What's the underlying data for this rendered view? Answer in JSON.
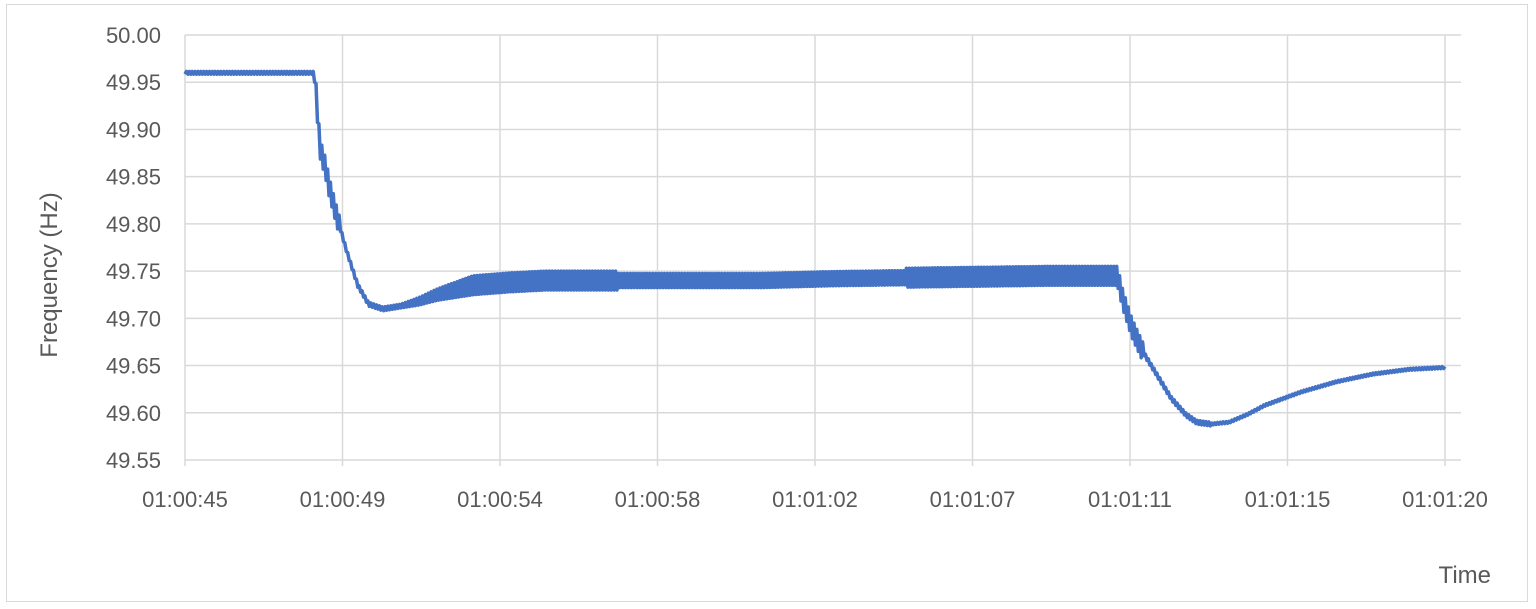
{
  "chart_data": {
    "type": "line",
    "xlabel": "Time",
    "ylabel": "Frequency (Hz)",
    "ylim": [
      49.55,
      50.0
    ],
    "y_ticks": [
      "49.55",
      "49.60",
      "49.65",
      "49.70",
      "49.75",
      "49.80",
      "49.85",
      "49.90",
      "49.95",
      "50.00"
    ],
    "x_tick_labels": [
      "01:00:45",
      "01:00:49",
      "01:00:54",
      "01:00:58",
      "01:01:02",
      "01:01:07",
      "01:01:11",
      "01:01:15",
      "01:01:20"
    ],
    "grid": true,
    "line_color": "#4472c4",
    "series": [
      {
        "x_seconds": [
          0,
          3.6,
          3.75,
          3.9,
          4.0,
          4.2,
          4.5,
          4.8,
          5.1,
          5.5,
          6.0,
          6.5,
          7.0,
          7.5,
          8.0,
          9.0,
          10.0,
          12.0,
          14.0,
          16.0,
          18.0,
          20.0,
          22.0,
          24.0,
          25.5,
          25.9,
          26.05,
          26.3,
          26.6,
          27.0,
          27.4,
          27.8,
          28.1,
          28.5,
          29.0,
          29.5,
          30.0,
          31.0,
          32.0,
          33.0,
          34.0,
          35.0
        ],
        "values": [
          49.96,
          49.96,
          49.88,
          49.86,
          49.84,
          49.81,
          49.77,
          49.735,
          49.715,
          49.71,
          49.713,
          49.718,
          49.725,
          49.73,
          49.735,
          49.738,
          49.74,
          49.74,
          49.74,
          49.74,
          49.742,
          49.743,
          49.744,
          49.745,
          49.745,
          49.745,
          49.72,
          49.69,
          49.665,
          49.64,
          49.615,
          49.598,
          49.59,
          49.588,
          49.59,
          49.598,
          49.608,
          49.622,
          49.633,
          49.641,
          49.646,
          49.648
        ]
      }
    ]
  }
}
